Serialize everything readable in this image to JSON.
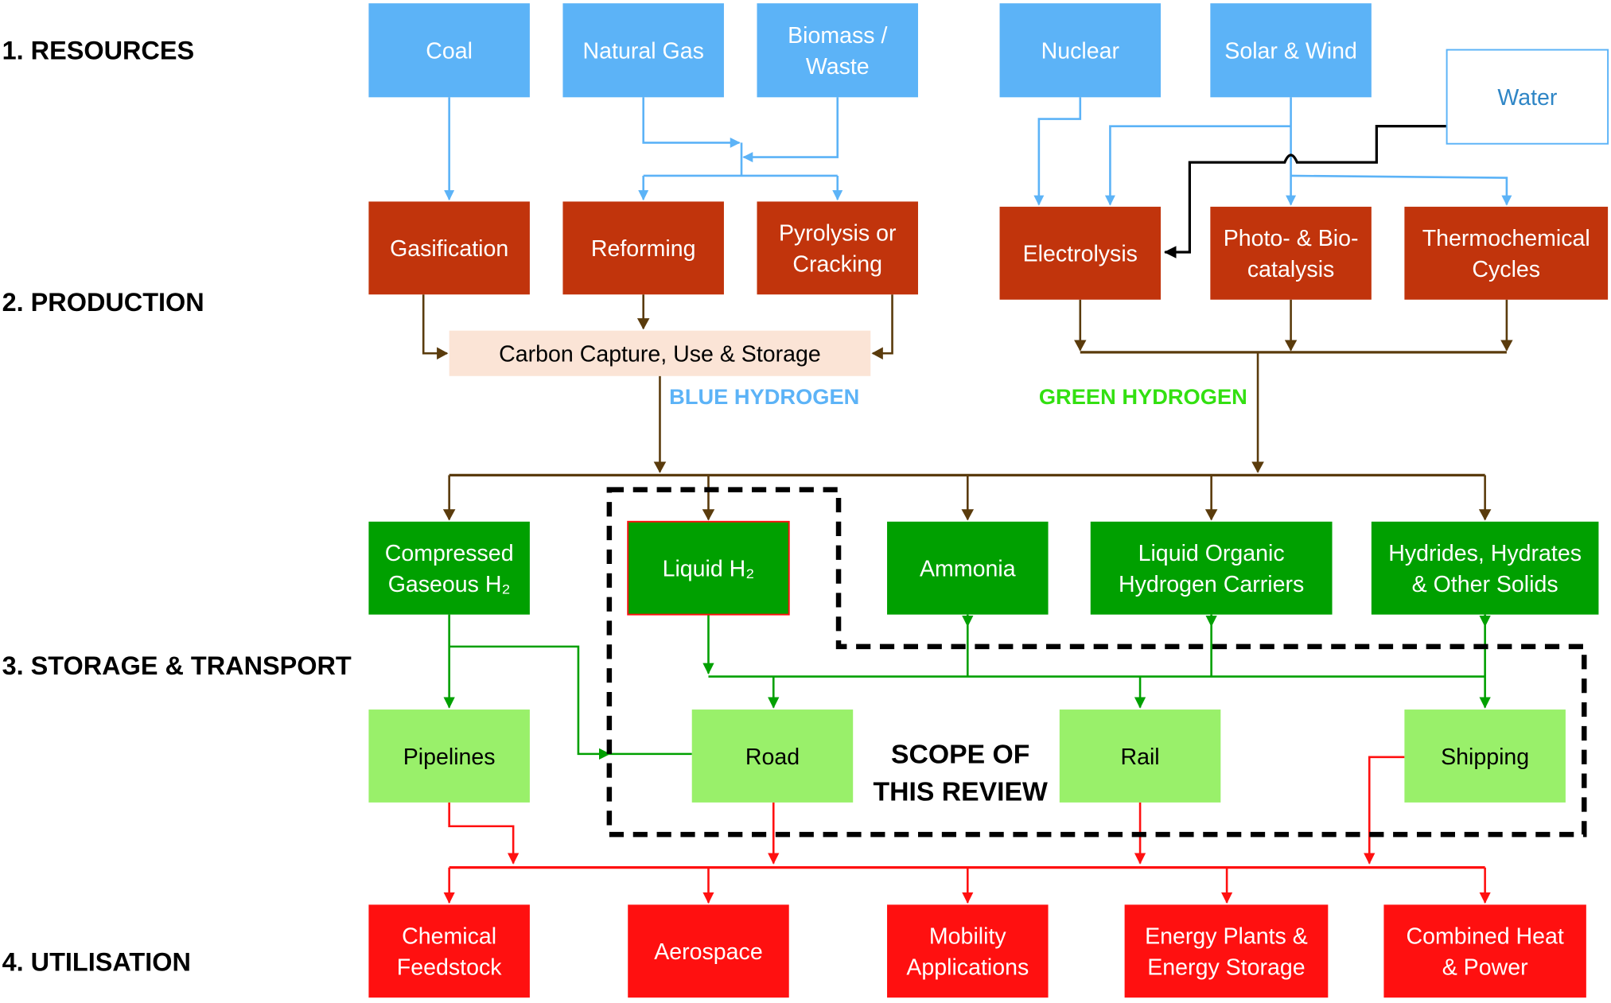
{
  "stages": [
    "1. RESOURCES",
    "2. PRODUCTION",
    "3. STORAGE & TRANSPORT",
    "4. UTILISATION"
  ],
  "colors": {
    "resource": "#5cb3f7",
    "production": "#c1340c",
    "ccus": "#fbe4d6",
    "storage": "#00a000",
    "transport": "#99f06a",
    "utilisation": "#ff1010",
    "blue_hydrogen": "#5cb3f7",
    "green_hydrogen": "#33e011",
    "flow_brown": "#5a3b0c"
  },
  "resources": [
    {
      "id": "coal",
      "lines": [
        "Coal"
      ]
    },
    {
      "id": "natural-gas",
      "lines": [
        "Natural Gas"
      ]
    },
    {
      "id": "biomass-waste",
      "lines": [
        "Biomass /",
        "Waste"
      ]
    },
    {
      "id": "nuclear",
      "lines": [
        "Nuclear"
      ]
    },
    {
      "id": "solar-wind",
      "lines": [
        "Solar & Wind"
      ]
    },
    {
      "id": "water",
      "lines": [
        "Water"
      ]
    }
  ],
  "production": [
    {
      "id": "gasification",
      "lines": [
        "Gasification"
      ]
    },
    {
      "id": "reforming",
      "lines": [
        "Reforming"
      ]
    },
    {
      "id": "pyrolysis-cracking",
      "lines": [
        "Pyrolysis or",
        "Cracking"
      ]
    },
    {
      "id": "electrolysis",
      "lines": [
        "Electrolysis"
      ]
    },
    {
      "id": "photo-bio-catalysis",
      "lines": [
        "Photo- & Bio-",
        "catalysis"
      ]
    },
    {
      "id": "thermochemical-cycles",
      "lines": [
        "Thermochemical",
        "Cycles"
      ]
    }
  ],
  "ccus": {
    "lines": [
      "Carbon Capture, Use & Storage"
    ]
  },
  "labels": {
    "blue_hydrogen": "BLUE HYDROGEN",
    "green_hydrogen": "GREEN HYDROGEN",
    "scope": [
      "SCOPE OF",
      "THIS REVIEW"
    ]
  },
  "storage": [
    {
      "id": "compressed-gaseous-h2",
      "lines": [
        "Compressed",
        "Gaseous H₂"
      ]
    },
    {
      "id": "liquid-h2",
      "lines": [
        "Liquid H₂"
      ]
    },
    {
      "id": "ammonia",
      "lines": [
        "Ammonia"
      ]
    },
    {
      "id": "lohc",
      "lines": [
        "Liquid Organic",
        "Hydrogen Carriers"
      ]
    },
    {
      "id": "hydrides-hydrates-solids",
      "lines": [
        "Hydrides, Hydrates",
        "& Other Solids"
      ]
    }
  ],
  "transport": [
    {
      "id": "pipelines",
      "lines": [
        "Pipelines"
      ]
    },
    {
      "id": "road",
      "lines": [
        "Road"
      ]
    },
    {
      "id": "rail",
      "lines": [
        "Rail"
      ]
    },
    {
      "id": "shipping",
      "lines": [
        "Shipping"
      ]
    }
  ],
  "utilisation": [
    {
      "id": "chemical-feedstock",
      "lines": [
        "Chemical",
        "Feedstock"
      ]
    },
    {
      "id": "aerospace",
      "lines": [
        "Aerospace"
      ]
    },
    {
      "id": "mobility-applications",
      "lines": [
        "Mobility",
        "Applications"
      ]
    },
    {
      "id": "energy-plants-storage",
      "lines": [
        "Energy Plants &",
        "Energy Storage"
      ]
    },
    {
      "id": "combined-heat-power",
      "lines": [
        "Combined Heat",
        "& Power"
      ]
    }
  ]
}
